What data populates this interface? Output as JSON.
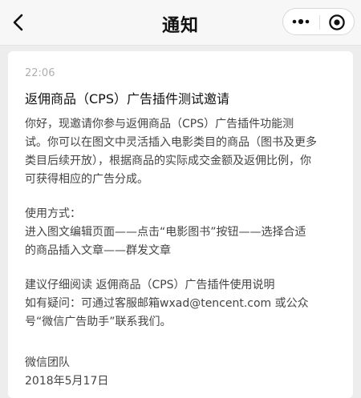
{
  "header": {
    "title": "通知"
  },
  "message": {
    "time": "22:06",
    "title": "返佣商品（CPS）广告插件测试邀请",
    "body_lines": [
      "你好，现邀请你参与返佣商品（CPS）广告插件功能测",
      "试。你可以在图文中灵活插入电影类目的商品（图书及更多",
      "类目后续开放），根据商品的实际成交金额及返佣比例，你",
      "可获得相应的广告分成。"
    ],
    "usage_lines": [
      "使用方式：",
      "进入图文编辑页面——点击“电影图书”按钮——选择合适",
      "的商品插入文章——群发文章"
    ],
    "help_lines": [
      "建议仔细阅读 返佣商品（CPS）广告插件使用说明",
      "如有疑问：可通过客服邮箱wxad@tencent.com 或公众",
      "号“微信广告助手”联系我们。"
    ],
    "signature": "微信团队",
    "date": "2018年5月17日"
  },
  "icons": {
    "back": "chevron-left-icon",
    "more": "more-dots-icon",
    "close": "target-circle-icon"
  }
}
